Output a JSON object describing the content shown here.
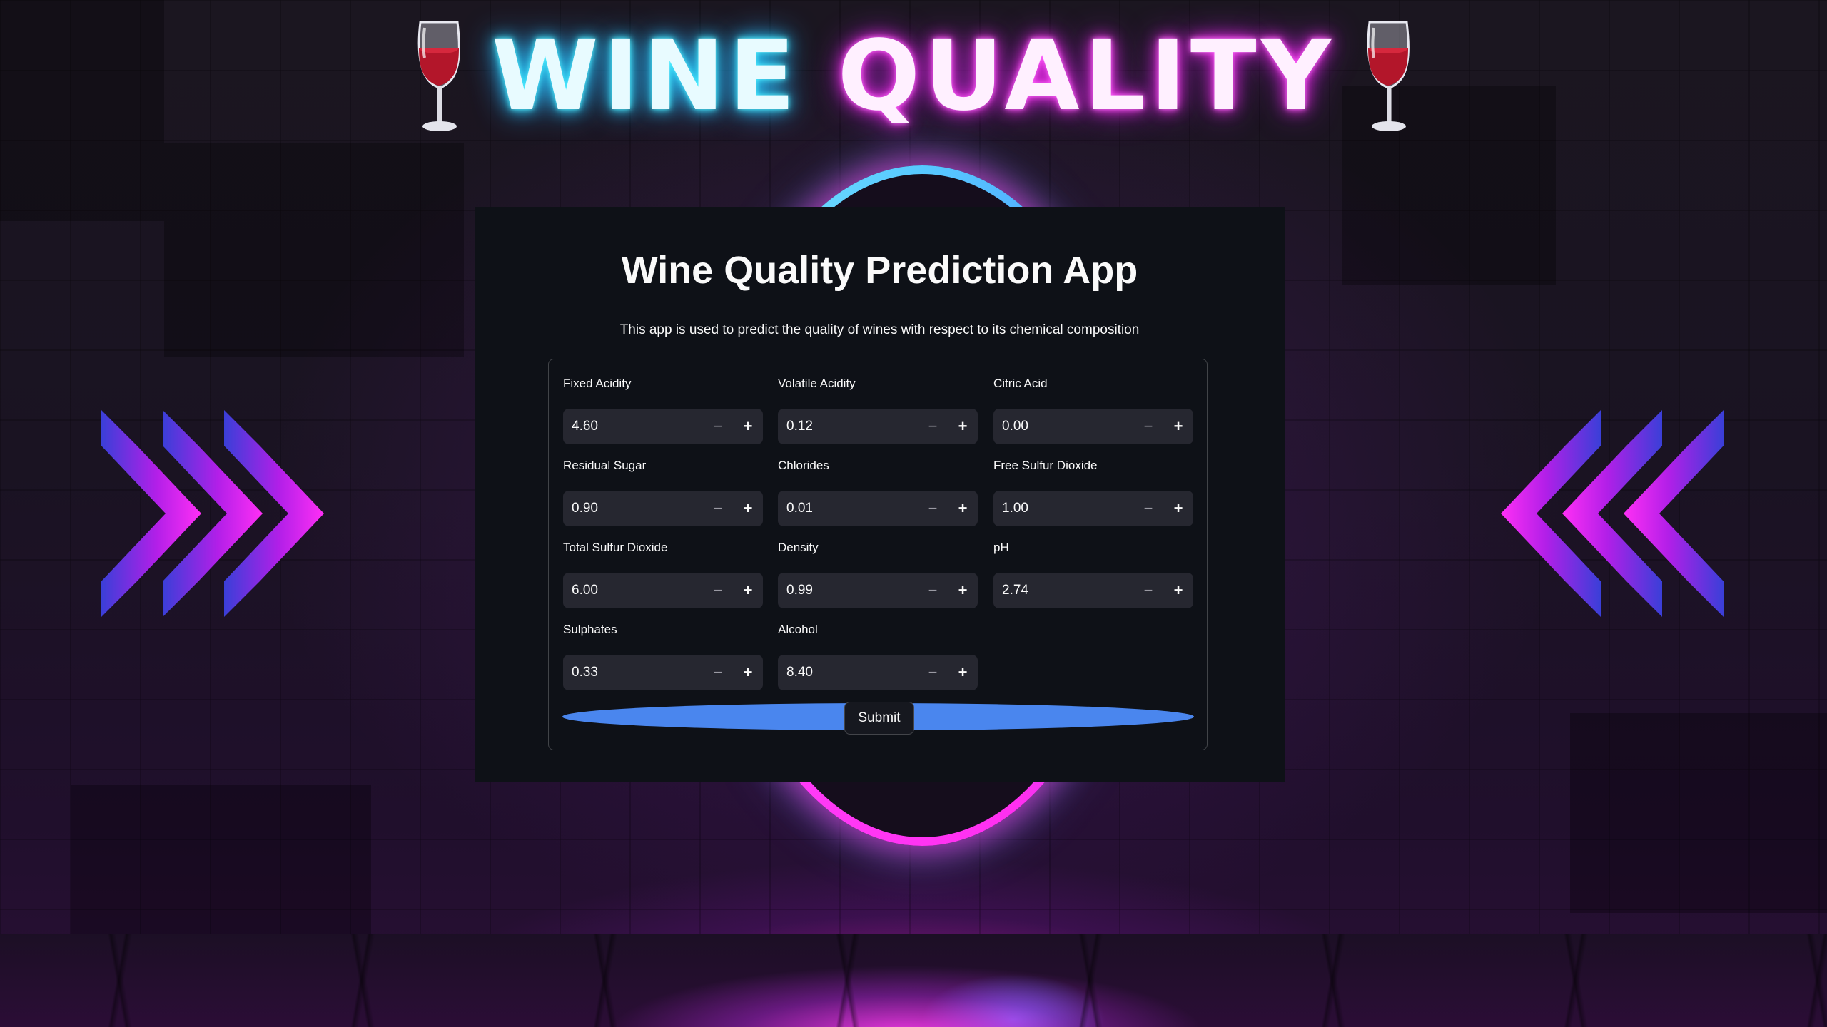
{
  "banner": {
    "word1": "WINE",
    "word2": "QUALITY",
    "left_icon": "wine-glass-icon",
    "right_icon": "wine-glass-icon"
  },
  "app": {
    "title": "Wine Quality Prediction App",
    "description": "This app is used to predict the quality of wines with respect to its chemical composition"
  },
  "form": {
    "fields": [
      {
        "label": "Fixed Acidity",
        "value": "4.60"
      },
      {
        "label": "Volatile Acidity",
        "value": "0.12"
      },
      {
        "label": "Citric Acid",
        "value": "0.00"
      },
      {
        "label": "Residual Sugar",
        "value": "0.90"
      },
      {
        "label": "Chlorides",
        "value": "0.01"
      },
      {
        "label": "Free Sulfur Dioxide",
        "value": "1.00"
      },
      {
        "label": "Total Sulfur Dioxide",
        "value": "6.00"
      },
      {
        "label": "Density",
        "value": "0.99"
      },
      {
        "label": "pH",
        "value": "2.74"
      },
      {
        "label": "Sulphates",
        "value": "0.33"
      },
      {
        "label": "Alcohol",
        "value": "8.40"
      }
    ],
    "minus_symbol": "−",
    "plus_symbol": "+",
    "submit_label": "Submit"
  },
  "colors": {
    "panel": "#0e1117",
    "input_bg": "#262730",
    "submit_bar": "#4a86ee",
    "neon_cyan": "#2ad7ff",
    "neon_magenta": "#ff2ff0"
  }
}
